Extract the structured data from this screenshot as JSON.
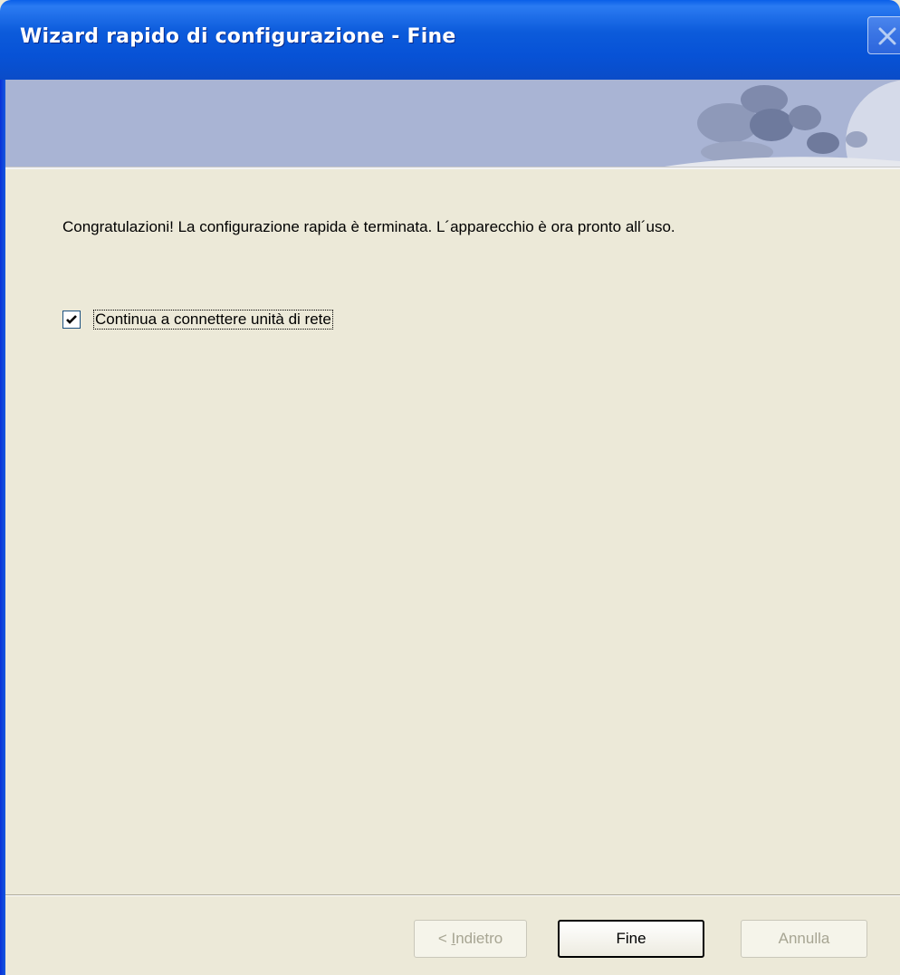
{
  "window": {
    "title": "Wizard rapido di configurazione - Fine"
  },
  "icons": {
    "close": "close-icon",
    "checkmark": "checkmark-icon",
    "banner_art": "bubbles-decoration"
  },
  "content": {
    "message": "Congratulazioni! La configurazione rapida è terminata. L´apparecchio è ora pronto all´uso.",
    "checkbox": {
      "label": "Continua a connettere unità di rete",
      "checked": true
    }
  },
  "buttons": {
    "back": {
      "prefix": "< ",
      "mnemonic": "I",
      "rest": "ndietro",
      "enabled": false
    },
    "finish": {
      "label": "Fine",
      "enabled": true,
      "default": true
    },
    "cancel": {
      "label": "Annulla",
      "enabled": false
    }
  },
  "colors": {
    "titlebar": "#0752D6",
    "dialog_bg": "#ECE9D8",
    "banner_bg": "#A9B4D4",
    "disabled_text": "#A7A593"
  }
}
